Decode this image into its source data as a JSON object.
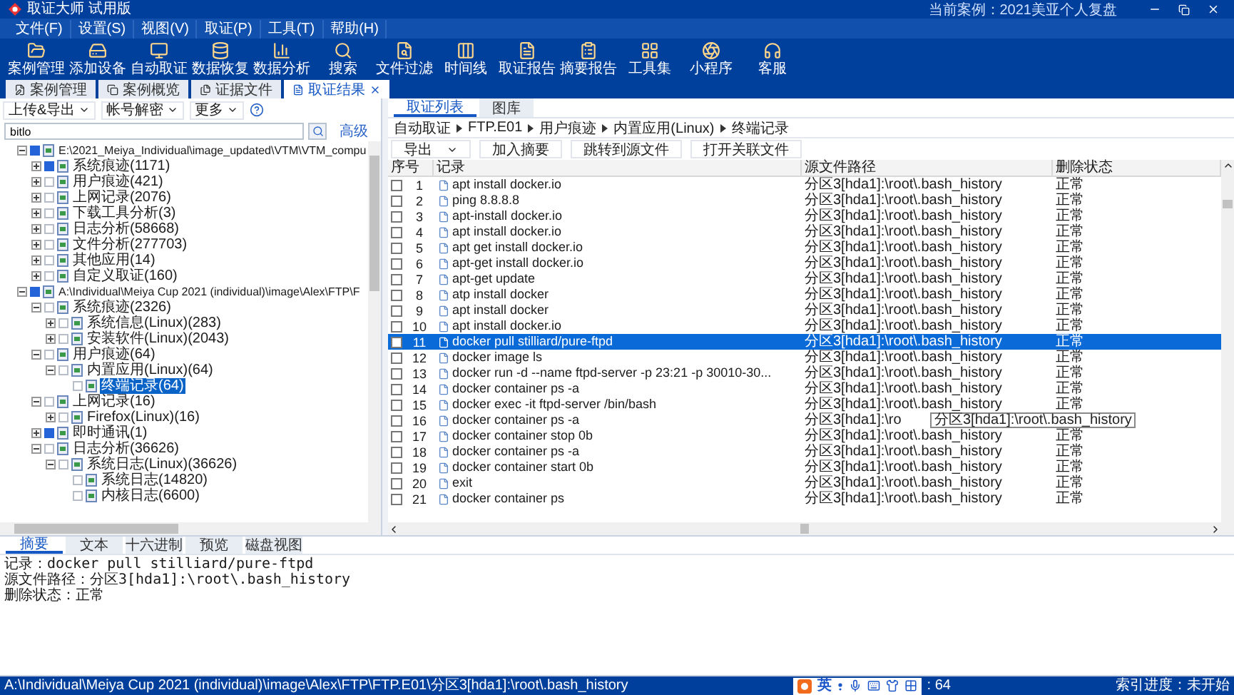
{
  "window": {
    "title": "取证大师 试用版",
    "current_case": "当前案例：2021美亚个人复盘"
  },
  "menu": [
    "文件(F)",
    "设置(S)",
    "视图(V)",
    "取证(P)",
    "工具(T)",
    "帮助(H)"
  ],
  "toolbar": [
    "案例管理",
    "添加设备",
    "自动取证",
    "数据恢复",
    "数据分析",
    "搜索",
    "文件过滤",
    "时间线",
    "取证报告",
    "摘要报告",
    "工具集",
    "小程序",
    "客服"
  ],
  "doc_tabs": [
    {
      "label": "案例管理",
      "selected": false
    },
    {
      "label": "案例概览",
      "selected": false
    },
    {
      "label": "证据文件",
      "selected": false
    },
    {
      "label": "取证结果",
      "selected": true
    }
  ],
  "left": {
    "actions": [
      "上传&导出",
      "帐号解密",
      "更多"
    ],
    "search": {
      "value": "bitlo"
    },
    "advanced_link": "高级",
    "tree": [
      {
        "label": "E:\\2021_Meiya_Individual\\image_updated\\VTM\\VTM_compu",
        "checked": true,
        "expanded": true,
        "selected": false,
        "children": [
          {
            "label": "系统痕迹(1171)",
            "checked": true,
            "expanded": false,
            "selected": false
          },
          {
            "label": "用户痕迹(421)",
            "checked": false,
            "expanded": false,
            "selected": false
          },
          {
            "label": "上网记录(2076)",
            "checked": false,
            "expanded": false,
            "selected": false
          },
          {
            "label": "下载工具分析(3)",
            "checked": false,
            "expanded": false,
            "selected": false
          },
          {
            "label": "日志分析(58668)",
            "checked": false,
            "expanded": false,
            "selected": false
          },
          {
            "label": "文件分析(277703)",
            "checked": false,
            "expanded": false,
            "selected": false
          },
          {
            "label": "其他应用(14)",
            "checked": false,
            "expanded": false,
            "selected": false
          },
          {
            "label": "自定义取证(160)",
            "checked": false,
            "expanded": false,
            "selected": false
          }
        ]
      },
      {
        "label": "A:\\Individual\\Meiya Cup 2021 (individual)\\image\\Alex\\FTP\\F",
        "checked": true,
        "expanded": true,
        "selected": false,
        "children": [
          {
            "label": "系统痕迹(2326)",
            "checked": false,
            "expanded": true,
            "selected": false,
            "children": [
              {
                "label": "系统信息(Linux)(283)",
                "checked": false,
                "expanded": false,
                "selected": false
              },
              {
                "label": "安装软件(Linux)(2043)",
                "checked": false,
                "expanded": false,
                "selected": false
              }
            ]
          },
          {
            "label": "用户痕迹(64)",
            "checked": false,
            "expanded": true,
            "selected": false,
            "children": [
              {
                "label": "内置应用(Linux)(64)",
                "checked": false,
                "expanded": true,
                "selected": false,
                "children": [
                  {
                    "label": "终端记录(64)",
                    "checked": false,
                    "selected": true
                  }
                ]
              }
            ]
          },
          {
            "label": "上网记录(16)",
            "checked": false,
            "expanded": true,
            "selected": false,
            "children": [
              {
                "label": "Firefox(Linux)(16)",
                "checked": false,
                "expanded": false,
                "selected": false
              }
            ]
          },
          {
            "label": "即时通讯(1)",
            "checked": true,
            "expanded": false,
            "selected": false
          },
          {
            "label": "日志分析(36626)",
            "checked": false,
            "expanded": true,
            "selected": false,
            "children": [
              {
                "label": "系统日志(Linux)(36626)",
                "checked": false,
                "expanded": true,
                "selected": false,
                "children": [
                  {
                    "label": "系统日志(14820)",
                    "checked": false,
                    "selected": false
                  },
                  {
                    "label": "内核日志(6600)",
                    "checked": false,
                    "selected": false
                  }
                ]
              }
            ]
          }
        ]
      }
    ]
  },
  "right": {
    "tabs": [
      {
        "label": "取证列表",
        "selected": true
      },
      {
        "label": "图库",
        "selected": false
      }
    ],
    "breadcrumb": [
      "自动取证",
      "FTP.E01",
      "用户痕迹",
      "内置应用(Linux)",
      "终端记录"
    ],
    "export_button": "导出",
    "buttons": [
      "加入摘要",
      "跳转到源文件",
      "打开关联文件"
    ],
    "table": {
      "columns": [
        "序号",
        "记录",
        "源文件路径",
        "删除状态"
      ],
      "rows": [
        {
          "no": "1",
          "record": "apt install docker.io",
          "path": "分区3[hda1]:\\root\\.bash_history",
          "status": "正常",
          "checked": false,
          "selected": false
        },
        {
          "no": "2",
          "record": "ping 8.8.8.8",
          "path": "分区3[hda1]:\\root\\.bash_history",
          "status": "正常",
          "checked": false,
          "selected": false
        },
        {
          "no": "3",
          "record": "apt-install docker.io",
          "path": "分区3[hda1]:\\root\\.bash_history",
          "status": "正常",
          "checked": false,
          "selected": false
        },
        {
          "no": "4",
          "record": "apt install docker.io",
          "path": "分区3[hda1]:\\root\\.bash_history",
          "status": "正常",
          "checked": false,
          "selected": false
        },
        {
          "no": "5",
          "record": "apt get install docker.io",
          "path": "分区3[hda1]:\\root\\.bash_history",
          "status": "正常",
          "checked": false,
          "selected": false
        },
        {
          "no": "6",
          "record": "apt-get install docker.io",
          "path": "分区3[hda1]:\\root\\.bash_history",
          "status": "正常",
          "checked": false,
          "selected": false
        },
        {
          "no": "7",
          "record": "apt-get update",
          "path": "分区3[hda1]:\\root\\.bash_history",
          "status": "正常",
          "checked": false,
          "selected": false
        },
        {
          "no": "8",
          "record": "atp install docker",
          "path": "分区3[hda1]:\\root\\.bash_history",
          "status": "正常",
          "checked": false,
          "selected": false
        },
        {
          "no": "9",
          "record": "apt install docker",
          "path": "分区3[hda1]:\\root\\.bash_history",
          "status": "正常",
          "checked": false,
          "selected": false
        },
        {
          "no": "10",
          "record": "apt install docker.io",
          "path": "分区3[hda1]:\\root\\.bash_history",
          "status": "正常",
          "checked": false,
          "selected": false
        },
        {
          "no": "11",
          "record": "docker pull stilliard/pure-ftpd",
          "path": "分区3[hda1]:\\root\\.bash_history",
          "status": "正常",
          "checked": false,
          "selected": true
        },
        {
          "no": "12",
          "record": "docker image ls",
          "path": "分区3[hda1]:\\root\\.bash_history",
          "status": "正常",
          "checked": false,
          "selected": false
        },
        {
          "no": "13",
          "record": "docker run -d --name ftpd-server -p 23:21 -p 30010-30...",
          "path": "分区3[hda1]:\\root\\.bash_history",
          "status": "正常",
          "checked": false,
          "selected": false
        },
        {
          "no": "14",
          "record": "docker container ps -a",
          "path": "分区3[hda1]:\\root\\.bash_history",
          "status": "正常",
          "checked": false,
          "selected": false
        },
        {
          "no": "15",
          "record": "docker exec -it ftpd-server /bin/bash",
          "path": "分区3[hda1]:\\root\\.bash_history",
          "status": "正常",
          "checked": false,
          "selected": false
        },
        {
          "no": "16",
          "record": "docker container ps -a",
          "path": "分区3[hda1]:\\ro",
          "checked": false,
          "selected": false
        },
        {
          "no": "17",
          "record": "docker container stop 0b",
          "path": "分区3[hda1]:\\root\\.bash_history",
          "status": "正常",
          "checked": false,
          "selected": false
        },
        {
          "no": "18",
          "record": "docker container ps -a",
          "path": "分区3[hda1]:\\root\\.bash_history",
          "status": "正常",
          "checked": false,
          "selected": false
        },
        {
          "no": "19",
          "record": "docker container start 0b",
          "path": "分区3[hda1]:\\root\\.bash_history",
          "status": "正常",
          "checked": false,
          "selected": false
        },
        {
          "no": "20",
          "record": "exit",
          "path": "分区3[hda1]:\\root\\.bash_history",
          "status": "正常",
          "checked": false,
          "selected": false
        },
        {
          "no": "21",
          "record": "docker container ps",
          "path": "分区3[hda1]:\\root\\.bash_history",
          "status": "正常",
          "checked": false,
          "selected": false
        }
      ],
      "tooltip": "分区3[hda1]:\\root\\.bash_history"
    }
  },
  "detail": {
    "tabs": [
      {
        "label": "摘要",
        "selected": true
      },
      {
        "label": "文本",
        "selected": false
      },
      {
        "label": "十六进制",
        "selected": false
      },
      {
        "label": "预览",
        "selected": false
      },
      {
        "label": "磁盘视图",
        "selected": false
      }
    ],
    "lines": [
      "记录：docker pull stilliard/pure-ftpd",
      "源文件路径：分区3[hda1]:\\root\\.bash_history",
      "删除状态：正常"
    ]
  },
  "status_bar": {
    "path": "A:\\Individual\\Meiya Cup 2021 (individual)\\image\\Alex\\FTP\\FTP.E01\\分区3[hda1]:\\root\\.bash_history",
    "ime_mode": "英",
    "count": ": 64",
    "index_progress": "索引进度：未开始"
  }
}
